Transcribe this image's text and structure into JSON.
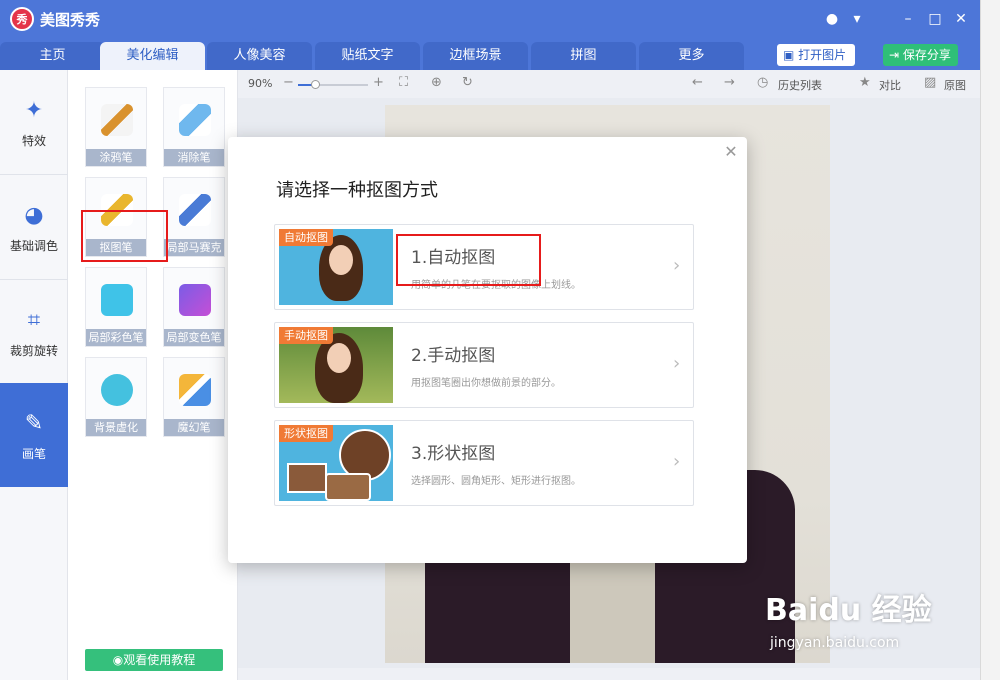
{
  "app": {
    "title": "美图秀秀",
    "logo_text": "秀"
  },
  "tabs": [
    {
      "label": "主页"
    },
    {
      "label": "美化编辑",
      "active": true
    },
    {
      "label": "人像美容"
    },
    {
      "label": "贴纸文字"
    },
    {
      "label": "边框场景"
    },
    {
      "label": "拼图"
    },
    {
      "label": "更多"
    }
  ],
  "header_buttons": {
    "open": "打开图片",
    "save": "保存分享"
  },
  "sidebar": [
    {
      "label": "特效",
      "icon": "magic-wand-icon"
    },
    {
      "label": "基础调色",
      "icon": "palette-icon"
    },
    {
      "label": "裁剪旋转",
      "icon": "crop-icon"
    },
    {
      "label": "画笔",
      "icon": "brush-icon",
      "active": true
    }
  ],
  "tools": [
    {
      "label": "涂鸦笔",
      "icon": "paintbrush-icon"
    },
    {
      "label": "消除笔",
      "icon": "eraser-icon"
    },
    {
      "label": "抠图笔",
      "icon": "cutout-pen-icon"
    },
    {
      "label": "局部马赛克",
      "icon": "mosaic-pen-icon"
    },
    {
      "label": "局部彩色笔",
      "icon": "color-brush-icon"
    },
    {
      "label": "局部变色笔",
      "icon": "recolor-brush-icon"
    },
    {
      "label": "背景虚化",
      "icon": "blur-icon"
    },
    {
      "label": "魔幻笔",
      "icon": "magic-pen-icon"
    }
  ],
  "tutorial_button": "观看使用教程",
  "canvas_toolbar": {
    "zoom": "90%",
    "zoom_level": 0.25,
    "history": "历史列表",
    "compare": "对比",
    "original": "原图"
  },
  "dialog": {
    "title": "请选择一种抠图方式",
    "options": [
      {
        "tag": "自动抠图",
        "title": "1.自动抠图",
        "desc": "用简单的几笔在要抠取的图像上划线。"
      },
      {
        "tag": "手动抠图",
        "title": "2.手动抠图",
        "desc": "用抠图笔圈出你想做前景的部分。"
      },
      {
        "tag": "形状抠图",
        "title": "3.形状抠图",
        "desc": "选择圆形、圆角矩形、矩形进行抠图。"
      }
    ]
  },
  "watermark": {
    "brand": "Baidu 经验",
    "url": "jingyan.baidu.com"
  },
  "colors": {
    "primary": "#4d76d8",
    "accent_red": "#e61b1b",
    "green": "#35c07c",
    "tag_orange": "#f07a35"
  }
}
